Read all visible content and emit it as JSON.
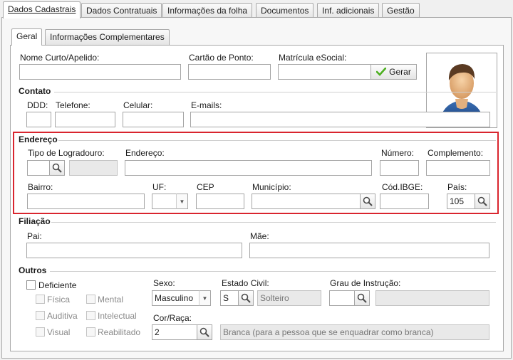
{
  "tabs": [
    "Dados Cadastrais",
    "Dados Contratuais",
    "Informações da folha",
    "Documentos",
    "Inf. adicionais",
    "Gestão"
  ],
  "subtabs": [
    "Geral",
    "Informações Complementares"
  ],
  "identity": {
    "nome_label": "Nome Curto/Apelido:",
    "cartao_label": "Cartão de Ponto:",
    "matricula_label": "Matrícula eSocial:",
    "gerar_label": "Gerar"
  },
  "contato": {
    "title": "Contato",
    "ddd_label": "DDD:",
    "telefone_label": "Telefone:",
    "celular_label": "Celular:",
    "emails_label": "E-mails:"
  },
  "endereco": {
    "title": "Endereço",
    "tipo_label": "Tipo de Logradouro:",
    "endereco_label": "Endereço:",
    "numero_label": "Número:",
    "complemento_label": "Complemento:",
    "bairro_label": "Bairro:",
    "uf_label": "UF:",
    "cep_label": "CEP",
    "municipio_label": "Município:",
    "ibge_label": "Cód.IBGE:",
    "pais_label": "País:",
    "pais_value": "105"
  },
  "filiacao": {
    "title": "Filiação",
    "pai_label": "Pai:",
    "mae_label": "Mãe:"
  },
  "outros": {
    "title": "Outros",
    "deficiente_label": "Deficiente",
    "fisica_label": "Física",
    "auditiva_label": "Auditiva",
    "visual_label": "Visual",
    "mental_label": "Mental",
    "intelectual_label": "Intelectual",
    "reabilitado_label": "Reabilitado",
    "sexo_label": "Sexo:",
    "sexo_value": "Masculino",
    "estado_civil_label": "Estado Civil:",
    "estado_civil_code": "S",
    "estado_civil_desc": "Solteiro",
    "grau_label": "Grau de Instrução:",
    "cor_label": "Cor/Raça:",
    "cor_code": "2",
    "cor_desc": "Branca (para a pessoa que se enquadrar como branca)"
  },
  "icons": [
    "search-icon",
    "check-icon",
    "dropdown-arrow-icon",
    "user-avatar-icon"
  ],
  "colors": {
    "highlight": "#d9252e",
    "check": "#4caf1f"
  }
}
